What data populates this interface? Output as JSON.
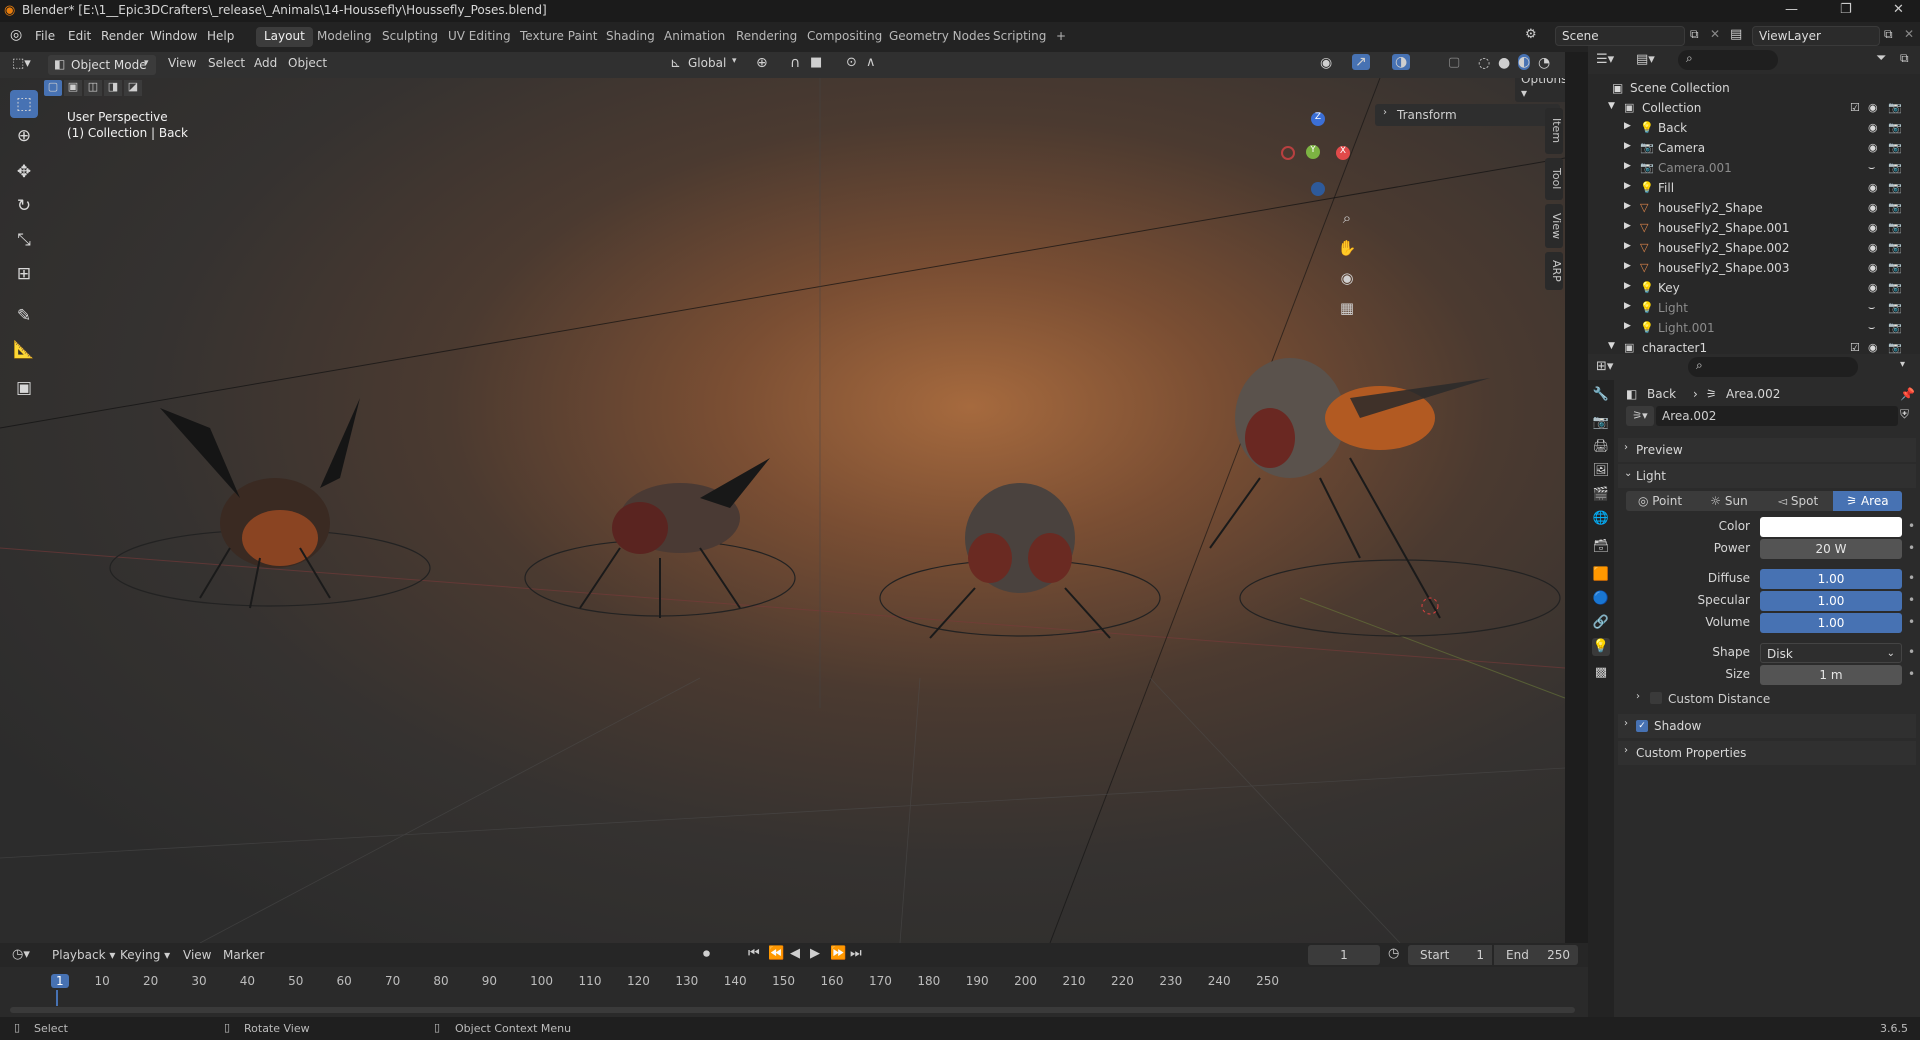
{
  "window": {
    "title": "Blender* [E:\\1__Epic3DCrafters\\_release\\_Animals\\14-Houssefly\\Houssefly_Poses.blend]"
  },
  "menu": [
    "File",
    "Edit",
    "Render",
    "Window",
    "Help"
  ],
  "workspaces": [
    "Layout",
    "Modeling",
    "Sculpting",
    "UV Editing",
    "Texture Paint",
    "Shading",
    "Animation",
    "Rendering",
    "Compositing",
    "Geometry Nodes",
    "Scripting"
  ],
  "scene": {
    "name": "Scene",
    "view_layer": "ViewLayer"
  },
  "viewport_header": {
    "mode": "Object Mode",
    "menus": [
      "View",
      "Select",
      "Add",
      "Object"
    ],
    "transform_orientation": "Global",
    "options": "Options"
  },
  "viewport": {
    "perspective": "User Perspective",
    "collection_info": "(1) Collection | Back",
    "transform_panel": "Transform",
    "side_tabs": [
      "Item",
      "Tool",
      "View",
      "ARP"
    ]
  },
  "gizmo": {
    "z": "Z",
    "y": "Y",
    "x": "X"
  },
  "outliner": {
    "root": "Scene Collection",
    "items": [
      {
        "name": "Collection",
        "level": 1,
        "type": "collection",
        "dim": false
      },
      {
        "name": "Back",
        "level": 2,
        "type": "light",
        "dim": false
      },
      {
        "name": "Camera",
        "level": 2,
        "type": "camera",
        "dim": false
      },
      {
        "name": "Camera.001",
        "level": 2,
        "type": "camera",
        "dim": true
      },
      {
        "name": "Fill",
        "level": 2,
        "type": "light",
        "dim": false
      },
      {
        "name": "houseFly2_Shape",
        "level": 2,
        "type": "mesh",
        "dim": false
      },
      {
        "name": "houseFly2_Shape.001",
        "level": 2,
        "type": "mesh",
        "dim": false
      },
      {
        "name": "houseFly2_Shape.002",
        "level": 2,
        "type": "mesh",
        "dim": false
      },
      {
        "name": "houseFly2_Shape.003",
        "level": 2,
        "type": "mesh",
        "dim": false
      },
      {
        "name": "Key",
        "level": 2,
        "type": "light",
        "dim": false
      },
      {
        "name": "Light",
        "level": 2,
        "type": "light",
        "dim": true
      },
      {
        "name": "Light.001",
        "level": 2,
        "type": "light",
        "dim": true
      },
      {
        "name": "character1",
        "level": 1,
        "type": "collection",
        "dim": false
      }
    ]
  },
  "properties": {
    "breadcrumb": [
      "Back",
      "Area.002"
    ],
    "datablock": "Area.002",
    "sections": {
      "preview": "Preview",
      "light": "Light",
      "custom_distance": "Custom Distance",
      "shadow": "Shadow",
      "custom_properties": "Custom Properties"
    },
    "light_types": [
      "Point",
      "Sun",
      "Spot",
      "Area"
    ],
    "active_type": "Area",
    "fields": [
      {
        "label": "Color",
        "value": ""
      },
      {
        "label": "Power",
        "value": "20 W"
      },
      {
        "label": "Diffuse",
        "value": "1.00"
      },
      {
        "label": "Specular",
        "value": "1.00"
      },
      {
        "label": "Volume",
        "value": "1.00"
      },
      {
        "label": "Shape",
        "value": "Disk"
      },
      {
        "label": "Size",
        "value": "1 m"
      }
    ]
  },
  "timeline": {
    "menus": [
      "Playback",
      "Keying",
      "View",
      "Marker"
    ],
    "current_frame": "1",
    "start_label": "Start",
    "start": "1",
    "end_label": "End",
    "end": "250",
    "ticks": [
      "1",
      "10",
      "20",
      "30",
      "40",
      "50",
      "60",
      "70",
      "80",
      "90",
      "100",
      "110",
      "120",
      "130",
      "140",
      "150",
      "160",
      "170",
      "180",
      "190",
      "200",
      "210",
      "220",
      "230",
      "240",
      "250"
    ]
  },
  "status": {
    "select": "Select",
    "rotate": "Rotate View",
    "context": "Object Context Menu",
    "version": "3.6.5"
  },
  "colors": {
    "accent": "#4772b3",
    "bg": "#1d1d1d",
    "panel": "#2b2b2b",
    "light_icon": "#e5914d",
    "mesh_icon": "#e0864a"
  }
}
